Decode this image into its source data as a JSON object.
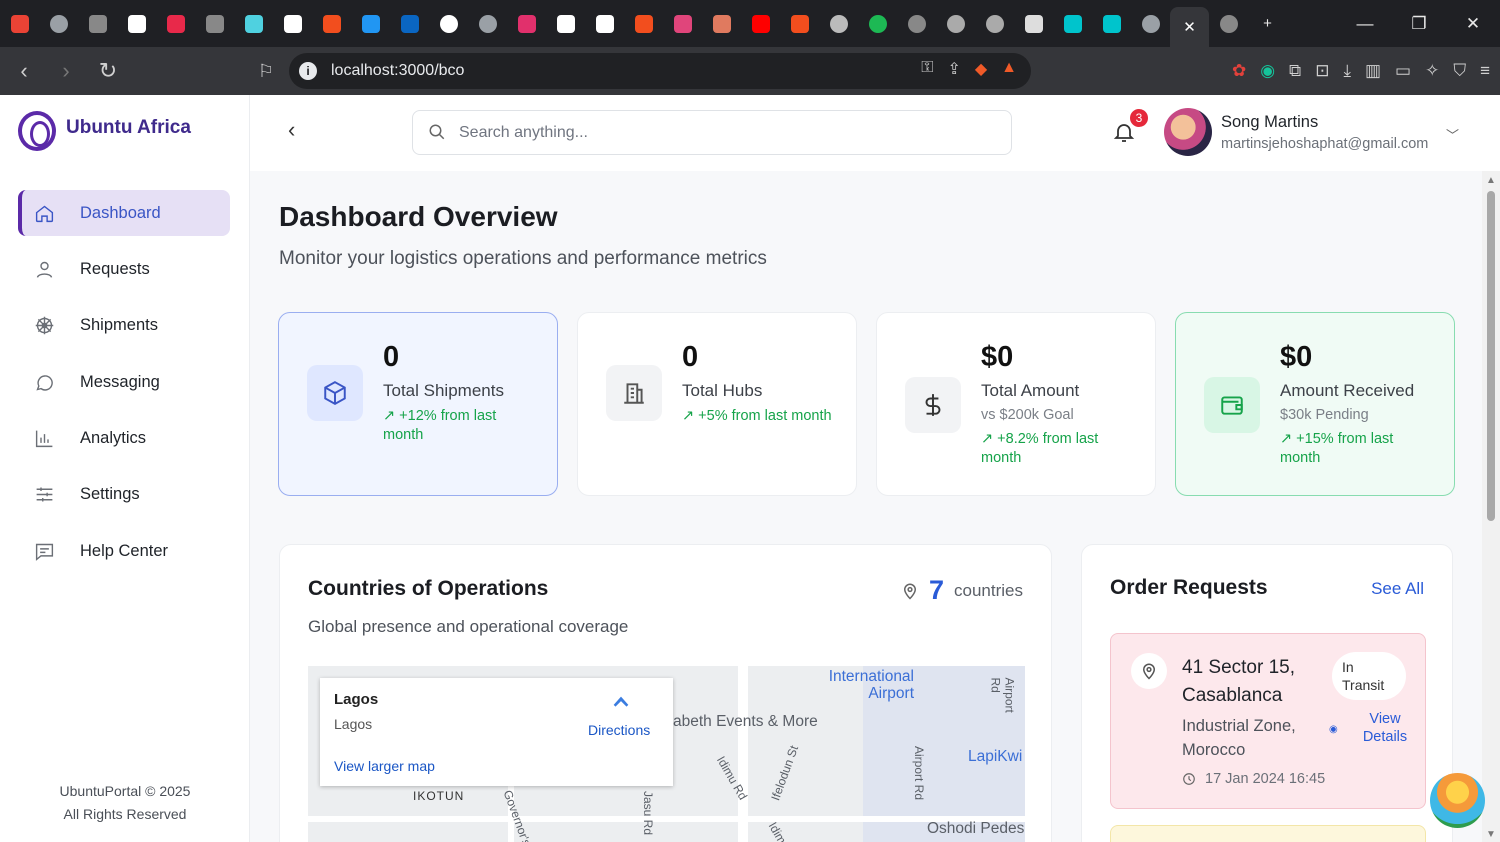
{
  "browser": {
    "url": "localhost:3000/bco",
    "tabs": [
      "gmail-icon",
      "globe-icon",
      "ai-icon",
      "github-icon",
      "app-icon",
      "chatgpt-icon",
      "diamond-icon",
      "x-icon",
      "figma-icon",
      "vuetify-icon",
      "linkedin-icon",
      "openai-icon",
      "globe-icon",
      "instagram-icon",
      "notion-icon",
      "vercel-icon",
      "figma-icon",
      "swirl-icon",
      "claude-icon",
      "youtube-icon",
      "figma-icon",
      "compass-icon",
      "spotify-icon",
      "loading-icon",
      "gemini-icon",
      "gemini-icon",
      "photo-icon",
      "canva-icon",
      "canva-icon",
      "globe-icon",
      "close-icon",
      "loading-icon"
    ],
    "brave_badge": "1",
    "alert_badge": "1"
  },
  "sidebar": {
    "brand": "Ubuntu Africa",
    "items": [
      {
        "label": "Dashboard",
        "icon": "home-icon",
        "active": true
      },
      {
        "label": "Requests",
        "icon": "user-icon"
      },
      {
        "label": "Shipments",
        "icon": "wheel-icon"
      },
      {
        "label": "Messaging",
        "icon": "chat-icon"
      },
      {
        "label": "Analytics",
        "icon": "bar-chart-icon"
      },
      {
        "label": "Settings",
        "icon": "sliders-icon"
      },
      {
        "label": "Help Center",
        "icon": "help-icon"
      }
    ],
    "footer_line1": "UbuntuPortal © 2025",
    "footer_line2": "All Rights Reserved"
  },
  "header": {
    "search_placeholder": "Search anything...",
    "notification_count": "3",
    "user_name": "Song Martins",
    "user_email": "martinsjehoshaphat@gmail.com"
  },
  "page": {
    "title": "Dashboard Overview",
    "subtitle": "Monitor your logistics operations and performance metrics"
  },
  "stats": [
    {
      "value": "0",
      "label": "Total Shipments",
      "sub": "",
      "trend": "↗ +12% from last month",
      "icon": "box-icon",
      "accent": "#3a55c5"
    },
    {
      "value": "0",
      "label": "Total Hubs",
      "sub": "",
      "trend": "↗ +5% from last month",
      "icon": "building-icon",
      "accent": "#555"
    },
    {
      "value": "$0",
      "label": "Total Amount",
      "sub": "vs $200k Goal",
      "trend": "↗ +8.2% from last month",
      "icon": "dollar-icon",
      "accent": "#333"
    },
    {
      "value": "$0",
      "label": "Amount Received",
      "sub": "$30k Pending",
      "trend": "↗ +15% from last month",
      "icon": "wallet-icon",
      "accent": "#16a34a"
    }
  ],
  "countries": {
    "title": "Countries of Operations",
    "subtitle": "Global presence and operational coverage",
    "count": "7",
    "count_label": "countries",
    "map": {
      "place_title": "Lagos",
      "place_sub": "Lagos",
      "directions": "Directions",
      "larger_map": "View larger map",
      "labels": [
        "International Airport",
        "abeth Events & More",
        "LapiKwi",
        "IKOTUN",
        "Idimu Rd",
        "Ifelodun St",
        "Airport Rd",
        "Airport Rd",
        "Oshodi Pedes",
        "Governor's",
        "Jasu Rd",
        "Idim"
      ]
    }
  },
  "orders": {
    "title": "Order Requests",
    "see_all": "See All",
    "items": [
      {
        "address": "41 Sector 15, Casablanca",
        "area": "Industrial Zone, Morocco",
        "status": "In Transit",
        "view": "View Details",
        "date": "17 Jan 2024 16:45"
      }
    ]
  }
}
